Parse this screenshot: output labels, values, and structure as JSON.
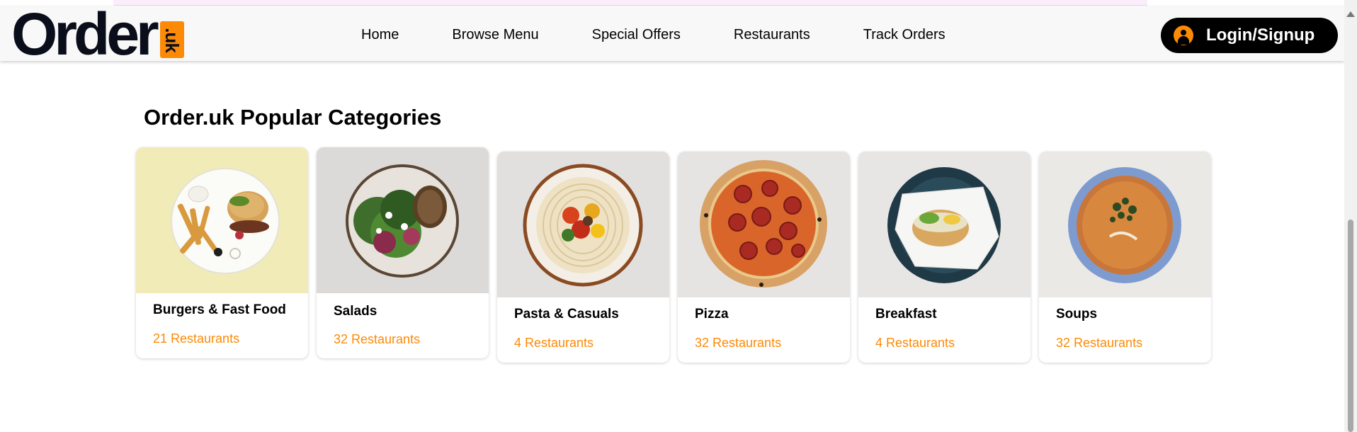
{
  "brand": {
    "name": "Order",
    "badge": ".uk"
  },
  "nav": {
    "links": [
      "Home",
      "Browse Menu",
      "Special Offers",
      "Restaurants",
      "Track Orders"
    ],
    "login_label": "Login/Signup"
  },
  "section": {
    "title": "Order.uk Popular Categories"
  },
  "categories": [
    {
      "name": "Burgers & Fast Food",
      "count": "21 Restaurants",
      "image": "burger-fries-plate"
    },
    {
      "name": "Salads",
      "count": "32 Restaurants",
      "image": "salad-bowl"
    },
    {
      "name": "Pasta & Casuals",
      "count": "4 Restaurants",
      "image": "pasta-plate"
    },
    {
      "name": "Pizza",
      "count": "32 Restaurants",
      "image": "pepperoni-pizza"
    },
    {
      "name": "Breakfast",
      "count": "4 Restaurants",
      "image": "breakfast-bagel"
    },
    {
      "name": "Soups",
      "count": "32 Restaurants",
      "image": "soup-bowl"
    }
  ],
  "colors": {
    "accent": "#fc8a06",
    "dark": "#0a0e1a",
    "navbar_bg": "#f8f8f8"
  }
}
